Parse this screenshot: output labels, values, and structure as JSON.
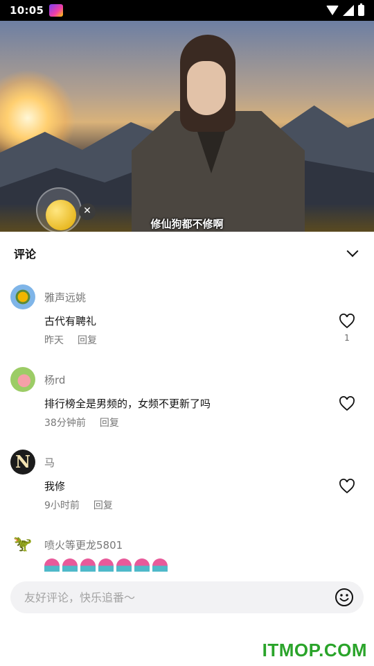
{
  "status_bar": {
    "time": "10:05",
    "icons": [
      "app-icon",
      "wifi-icon",
      "signal-icon",
      "battery-icon"
    ]
  },
  "video": {
    "subtitle": "修仙狗都不修啊"
  },
  "comments_panel": {
    "title": "评论",
    "collapse_icon": "chevron-down-icon",
    "items": [
      {
        "username": "雅声远姚",
        "text": "古代有聘礼",
        "time": "昨天",
        "reply": "回复",
        "likes": "1"
      },
      {
        "username": "杨rd",
        "text": "排行榜全是男频的，女频不更新了吗",
        "time": "38分钟前",
        "reply": "回复",
        "likes": ""
      },
      {
        "username": "马",
        "avatar_letter": "N",
        "text": "我修",
        "time": "9小时前",
        "reply": "回复",
        "likes": ""
      },
      {
        "username": "喷火等更龙5801",
        "text": "",
        "time": "",
        "reply": "",
        "likes": ""
      }
    ]
  },
  "input": {
    "placeholder": "友好评论，快乐追番～",
    "emoji_icon": "smile-icon"
  },
  "watermark": "ITMOP.COM",
  "colors": {
    "accent_green": "#2aa42a",
    "input_bg": "#f2f2f4",
    "meta_gray": "#777777"
  }
}
